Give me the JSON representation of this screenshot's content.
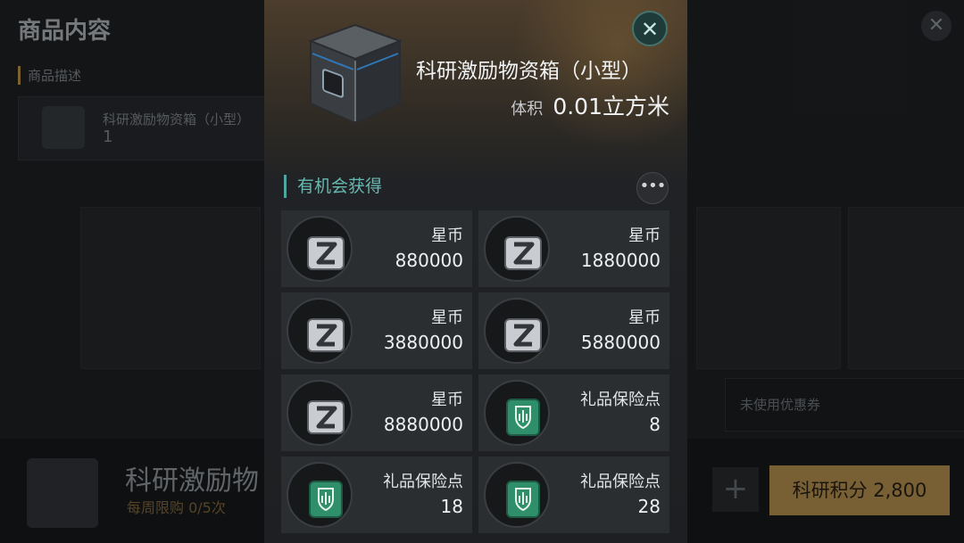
{
  "background": {
    "title": "商品内容",
    "section_label": "商品描述",
    "desc_item_name": "科研激励物资箱（小型）",
    "desc_item_qty": "1",
    "coupon_placeholder": "未使用优惠券",
    "bottom_item_name": "科研激励物",
    "weekly_limit": "每周限购 0/5次",
    "plus_label": "+",
    "buy_label": "科研积分 2,800",
    "close_label": "✕"
  },
  "modal": {
    "item_name": "科研激励物资箱（小型）",
    "volume_label": "体积",
    "volume_value": "0.01立方米",
    "close_label": "✕",
    "chance_header": "有机会获得",
    "more_label": "•••",
    "rewards": [
      {
        "name": "星币",
        "amount": "880000",
        "icon": "star-coin-icon"
      },
      {
        "name": "星币",
        "amount": "1880000",
        "icon": "star-coin-icon"
      },
      {
        "name": "星币",
        "amount": "3880000",
        "icon": "star-coin-icon"
      },
      {
        "name": "星币",
        "amount": "5880000",
        "icon": "star-coin-icon"
      },
      {
        "name": "星币",
        "amount": "8880000",
        "icon": "star-coin-icon"
      },
      {
        "name": "礼品保险点",
        "amount": "8",
        "icon": "gift-insurance-icon"
      },
      {
        "name": "礼品保险点",
        "amount": "18",
        "icon": "gift-insurance-icon"
      },
      {
        "name": "礼品保险点",
        "amount": "28",
        "icon": "gift-insurance-icon"
      }
    ]
  },
  "colors": {
    "accent_teal": "#68b9b2",
    "buy_gold": "#c29a55",
    "insurance_green": "#2f8f6a"
  }
}
